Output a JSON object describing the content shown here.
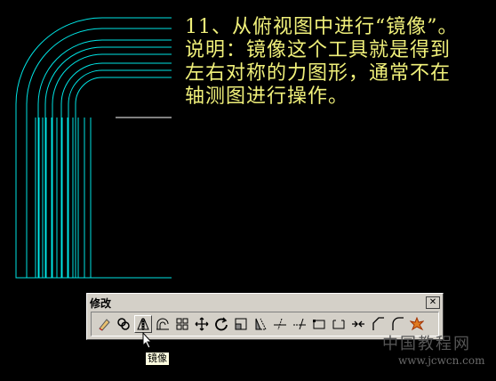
{
  "instruction": {
    "lines": [
      "11、从俯视图中进行“镜像”。",
      "说明：镜像这个工具就是得到",
      "左右对称的力图形，通常不在",
      "轴测图进行操作。"
    ]
  },
  "toolbar": {
    "title": "修改",
    "close_label": "✕",
    "tools": [
      {
        "name": "erase",
        "icon": "eraser-icon"
      },
      {
        "name": "copy",
        "icon": "copy-icon"
      },
      {
        "name": "mirror",
        "icon": "mirror-icon",
        "active": true
      },
      {
        "name": "offset",
        "icon": "offset-icon"
      },
      {
        "name": "array",
        "icon": "array-icon"
      },
      {
        "name": "move",
        "icon": "move-icon"
      },
      {
        "name": "rotate",
        "icon": "rotate-icon"
      },
      {
        "name": "scale",
        "icon": "scale-icon"
      },
      {
        "name": "stretch",
        "icon": "stretch-icon"
      },
      {
        "name": "trim",
        "icon": "trim-icon"
      },
      {
        "name": "extend",
        "icon": "extend-icon"
      },
      {
        "name": "break-at-point",
        "icon": "break-at-point-icon"
      },
      {
        "name": "break",
        "icon": "break-icon"
      },
      {
        "name": "join",
        "icon": "join-icon"
      },
      {
        "name": "chamfer",
        "icon": "chamfer-icon"
      },
      {
        "name": "fillet",
        "icon": "fillet-icon"
      },
      {
        "name": "explode",
        "icon": "explode-icon"
      }
    ]
  },
  "tooltip": {
    "text": "镜像"
  },
  "watermark": {
    "line1": "中国教程网",
    "line2": "www.jcwcn.com"
  },
  "colors": {
    "drawing": "#00e5e5",
    "text": "#f0f07a",
    "background": "#000000",
    "toolbar": "#d4d0c8"
  }
}
